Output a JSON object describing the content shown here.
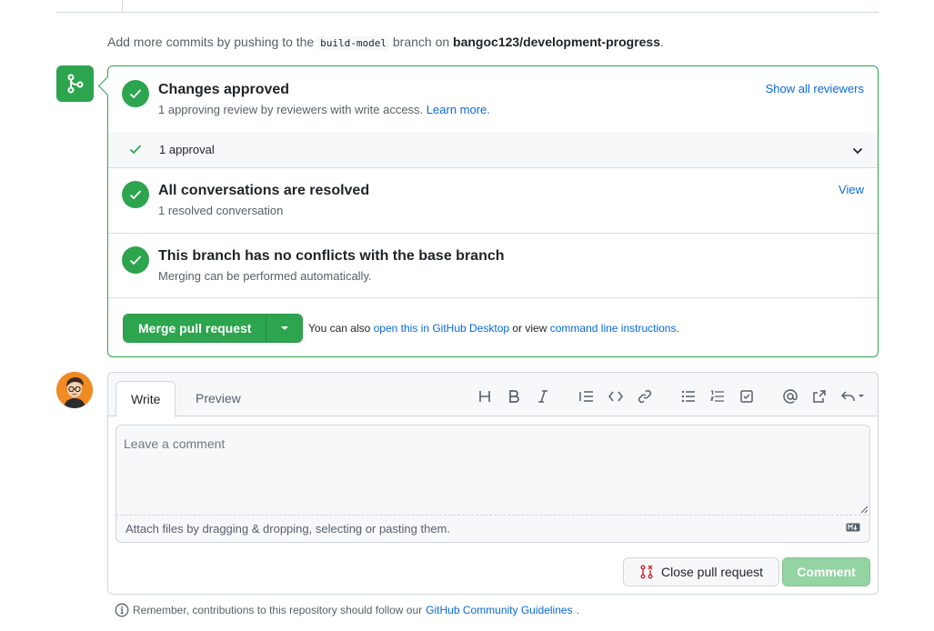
{
  "hint": {
    "prefix": "Add more commits by pushing to the",
    "branch": "build-model",
    "middle": "branch on",
    "repo": "bangoc123/development-progress",
    "suffix": "."
  },
  "checks": {
    "approved_title": "Changes approved",
    "approved_sub": "1 approving review by reviewers with write access.",
    "learn_more": "Learn more.",
    "show_reviewers": "Show all reviewers",
    "approval_count": "1 approval",
    "conversations_title": "All conversations are resolved",
    "conversations_sub": "1 resolved conversation",
    "view_link": "View",
    "conflicts_title": "This branch has no conflicts with the base branch",
    "conflicts_sub": "Merging can be performed automatically."
  },
  "merge": {
    "button_label": "Merge pull request",
    "also_prefix": "You can also",
    "desktop_link": "open this in GitHub Desktop",
    "or_view": "or view",
    "cli_link": "command line instructions",
    "period": "."
  },
  "comment": {
    "tab_write": "Write",
    "tab_preview": "Preview",
    "placeholder": "Leave a comment",
    "attach_text": "Attach files by dragging & dropping, selecting or pasting them.",
    "close_label": "Close pull request",
    "comment_label": "Comment"
  },
  "footer": {
    "remember_prefix": "Remember, contributions to this repository should follow our",
    "guidelines_link": "GitHub Community Guidelines",
    "period": "."
  },
  "colors": {
    "success": "#2da44e",
    "link": "#0969da",
    "danger": "#cf222e"
  }
}
